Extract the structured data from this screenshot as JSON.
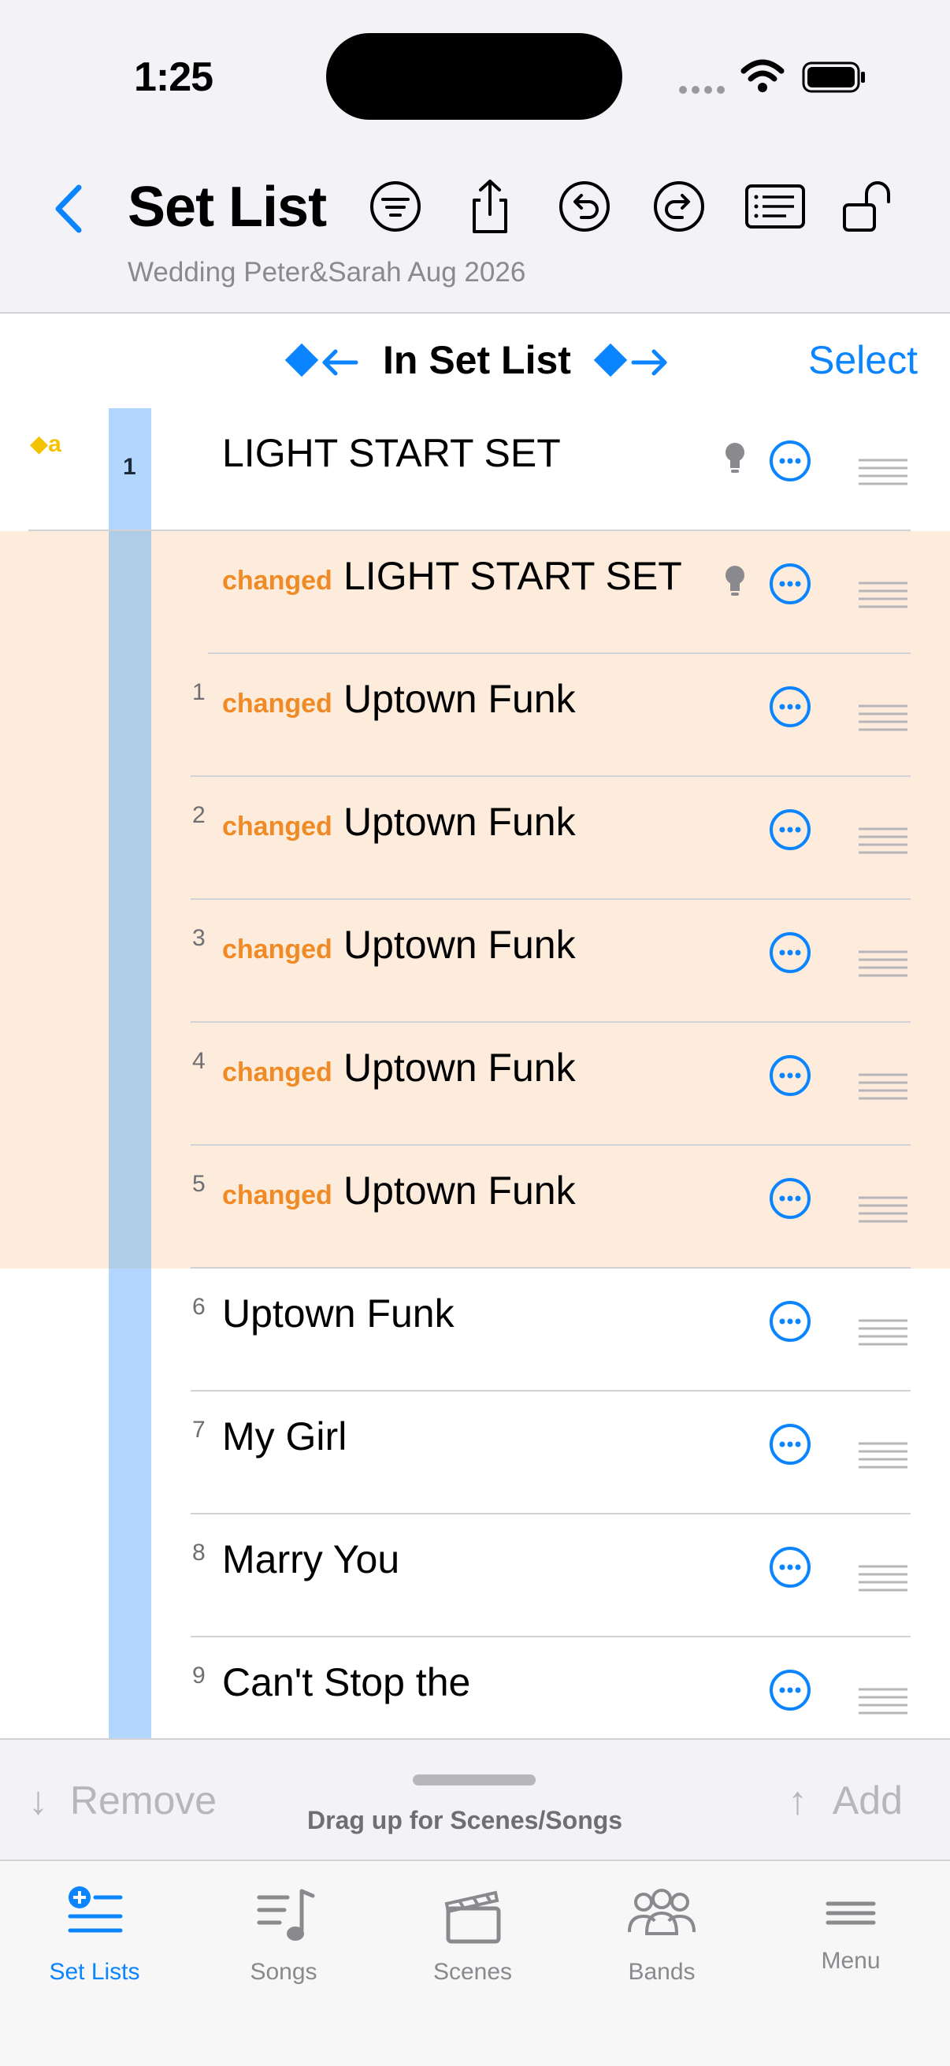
{
  "status": {
    "time": "1:25"
  },
  "header": {
    "back_label": "",
    "title": "Set List",
    "subtitle": "Wedding Peter&Sarah Aug 2026",
    "tools": [
      "filter-icon",
      "share-icon",
      "undo-icon",
      "redo-icon",
      "list-detail-icon",
      "unlock-icon"
    ]
  },
  "filter_bar": {
    "title": "In Set List",
    "select_label": "Select"
  },
  "set_marker": {
    "letter": "a",
    "set_number": "1"
  },
  "rows": [
    {
      "num": "",
      "changed": "",
      "name": "LIGHT START SET",
      "bulb": true
    },
    {
      "num": "",
      "changed": "changed",
      "name": "LIGHT START SET",
      "bulb": true
    },
    {
      "num": "1",
      "changed": "changed",
      "name": "Uptown Funk",
      "bulb": false
    },
    {
      "num": "2",
      "changed": "changed",
      "name": "Uptown Funk",
      "bulb": false
    },
    {
      "num": "3",
      "changed": "changed",
      "name": "Uptown Funk",
      "bulb": false
    },
    {
      "num": "4",
      "changed": "changed",
      "name": "Uptown Funk",
      "bulb": false
    },
    {
      "num": "5",
      "changed": "changed",
      "name": "Uptown Funk",
      "bulb": false
    },
    {
      "num": "6",
      "changed": "",
      "name": "Uptown Funk",
      "bulb": false
    },
    {
      "num": "7",
      "changed": "",
      "name": "My Girl",
      "bulb": false
    },
    {
      "num": "8",
      "changed": "",
      "name": "Marry You",
      "bulb": false
    },
    {
      "num": "9",
      "changed": "",
      "name": "Can't Stop the",
      "bulb": false
    }
  ],
  "action_bar": {
    "remove_label": "Remove",
    "add_label": "Add",
    "hint": "Drag up for Scenes/Songs"
  },
  "tabs": [
    {
      "label": "Set Lists",
      "icon": "set-lists-icon",
      "active": true
    },
    {
      "label": "Songs",
      "icon": "songs-icon",
      "active": false
    },
    {
      "label": "Scenes",
      "icon": "scenes-icon",
      "active": false
    },
    {
      "label": "Bands",
      "icon": "bands-icon",
      "active": false
    },
    {
      "label": "Menu",
      "icon": "menu-icon",
      "active": false
    }
  ],
  "colors": {
    "accent": "#0a84ff",
    "changed": "#f08a24",
    "highlight": "#fdebdc",
    "set_bar": "#b2d6fd",
    "marker": "#f5c200"
  }
}
